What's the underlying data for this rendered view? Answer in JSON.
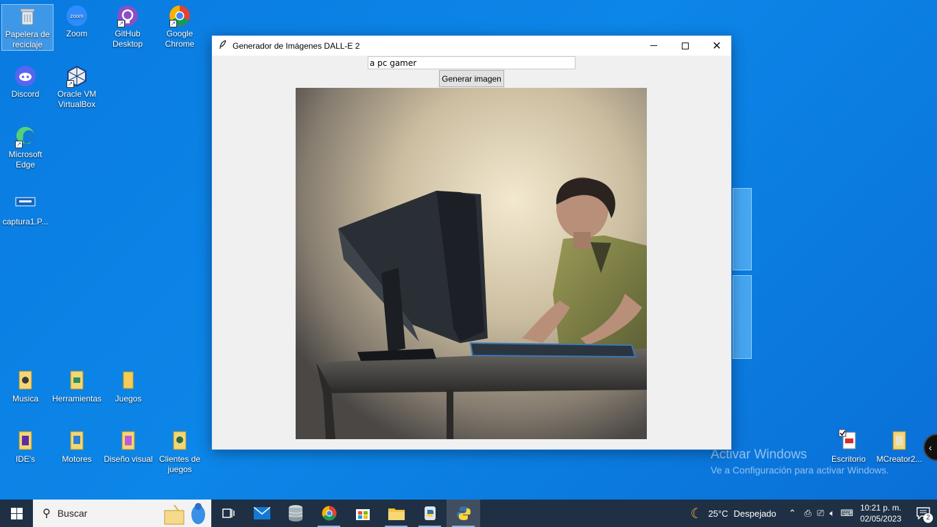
{
  "desktop": {
    "icons": [
      {
        "label": "Papelera de reciclaje",
        "icon": "recycle-bin-icon"
      },
      {
        "label": "Zoom",
        "icon": "zoom-icon"
      },
      {
        "label": "GitHub Desktop",
        "icon": "github-icon"
      },
      {
        "label": "Google Chrome",
        "icon": "chrome-icon"
      },
      {
        "label": "Discord",
        "icon": "discord-icon"
      },
      {
        "label": "Oracle VM VirtualBox",
        "icon": "virtualbox-icon"
      },
      {
        "label": "Microsoft Edge",
        "icon": "edge-icon"
      },
      {
        "label": "captura1.P...",
        "icon": "file-icon"
      },
      {
        "label": "Musica",
        "icon": "folder-icon"
      },
      {
        "label": "Herramientas",
        "icon": "folder-icon"
      },
      {
        "label": "Juegos",
        "icon": "folder-icon"
      },
      {
        "label": "IDE's",
        "icon": "folder-icon"
      },
      {
        "label": "Motores",
        "icon": "folder-icon"
      },
      {
        "label": "Diseño visual",
        "icon": "folder-icon"
      },
      {
        "label": "Clientes de juegos",
        "icon": "folder-icon"
      },
      {
        "label": "Escritorio",
        "icon": "pdf-icon"
      },
      {
        "label": "MCreator2...",
        "icon": "folder-icon"
      }
    ],
    "watermark_line1": "Activar Windows",
    "watermark_line2": "Ve a Configuración para activar Windows."
  },
  "window": {
    "title": "Generador de Imágenes DALL-E 2",
    "prompt_value": "a pc gamer",
    "generate_label": "Generar imagen",
    "image_alt": "a pc gamer"
  },
  "taskbar": {
    "search_placeholder": "Buscar",
    "weather_temp": "25°C",
    "weather_text": "Despejado",
    "time": "10:21 p. m.",
    "date": "02/05/2023",
    "notifications": "2"
  }
}
